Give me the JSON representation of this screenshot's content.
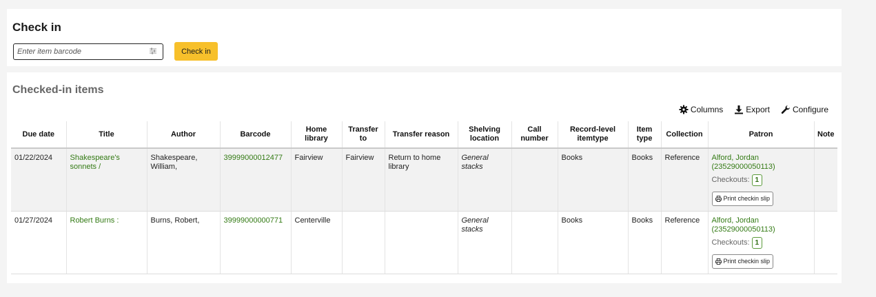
{
  "checkin": {
    "title": "Check in",
    "barcode_placeholder": "Enter item barcode",
    "button_label": "Check in"
  },
  "checked_in": {
    "title": "Checked-in items",
    "toolbar": {
      "columns": "Columns",
      "export": "Export",
      "configure": "Configure"
    },
    "headers": {
      "due_date": "Due date",
      "title": "Title",
      "author": "Author",
      "barcode": "Barcode",
      "home_library": "Home library",
      "transfer_to": "Transfer to",
      "transfer_reason": "Transfer reason",
      "shelving_location": "Shelving location",
      "call_number": "Call number",
      "record_level_itemtype": "Record-level itemtype",
      "item_type": "Item type",
      "collection": "Collection",
      "patron": "Patron",
      "note": "Note"
    },
    "rows": [
      {
        "due_date": "01/22/2024",
        "title": "Shakespeare's sonnets /",
        "author": "Shakespeare, William,",
        "barcode": "39999000012477",
        "home_library": "Fairview",
        "transfer_to": "Fairview",
        "transfer_reason": "Return to home library",
        "shelving_location": "General stacks",
        "call_number": "",
        "record_level_itemtype": "Books",
        "item_type": "Books",
        "collection": "Reference",
        "patron_name": "Alford, Jordan",
        "patron_card": "(23529000050113)",
        "checkouts_label": "Checkouts:",
        "checkouts_count": "1",
        "print_label": "Print checkin slip",
        "note": ""
      },
      {
        "due_date": "01/27/2024",
        "title": "Robert Burns :",
        "author": "Burns, Robert,",
        "barcode": "39999000000771",
        "home_library": "Centerville",
        "transfer_to": "",
        "transfer_reason": "",
        "shelving_location": "General stacks",
        "call_number": "",
        "record_level_itemtype": "Books",
        "item_type": "Books",
        "collection": "Reference",
        "patron_name": "Alford, Jordan",
        "patron_card": "(23529000050113)",
        "checkouts_label": "Checkouts:",
        "checkouts_count": "1",
        "print_label": "Print checkin slip",
        "note": ""
      }
    ]
  },
  "colors": {
    "accent_button": "#f7c02b",
    "link": "#337a14",
    "badge_border": "#5a9a3a"
  }
}
